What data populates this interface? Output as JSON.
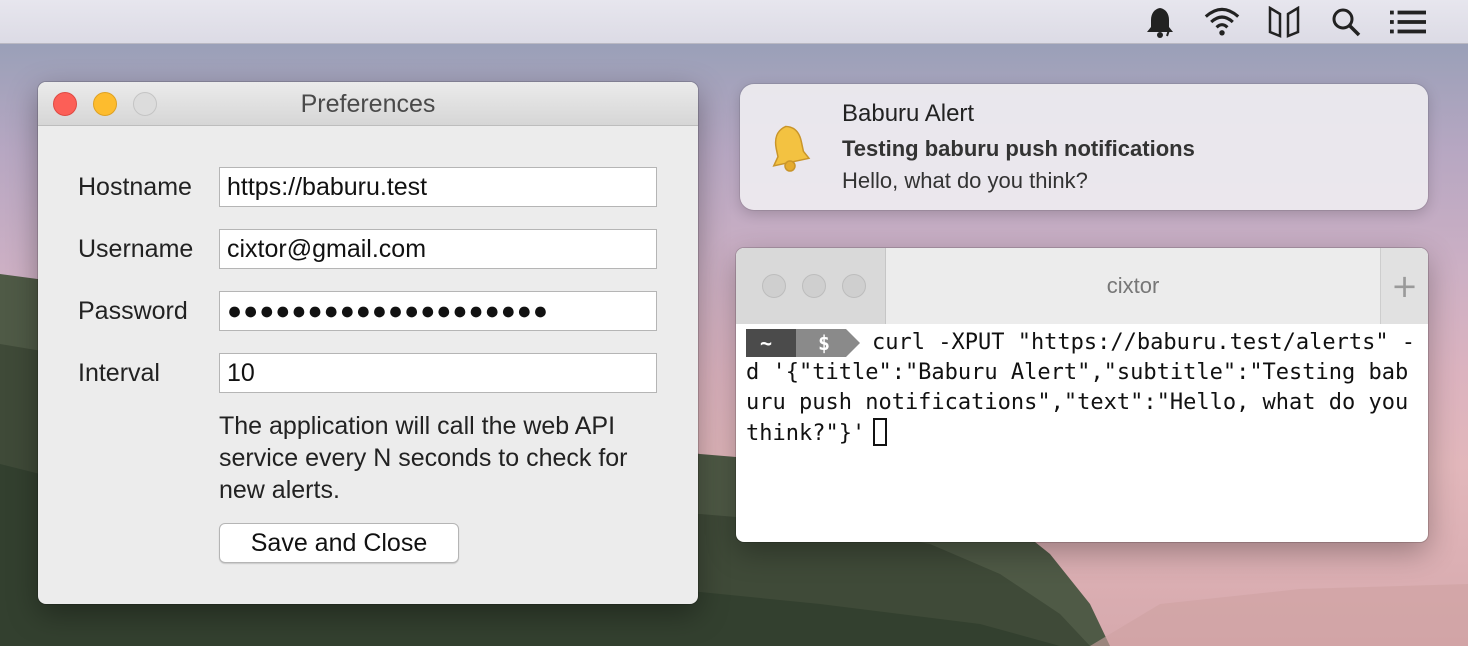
{
  "menubar": {
    "icons": [
      "bell-icon",
      "wifi-icon",
      "sidebar-split-icon",
      "search-icon",
      "list-icon"
    ]
  },
  "preferences": {
    "title": "Preferences",
    "fields": [
      {
        "label": "Hostname",
        "value": "https://baburu.test"
      },
      {
        "label": "Username",
        "value": "cixtor@gmail.com"
      },
      {
        "label": "Password",
        "value": "●●●●●●●●●●●●●●●●●●●●"
      },
      {
        "label": "Interval",
        "value": "10"
      }
    ],
    "hint": "The application will call the web API service every N seconds to check for new alerts.",
    "save_label": "Save and Close"
  },
  "notification": {
    "title": "Baburu Alert",
    "subtitle": "Testing baburu push notifications",
    "text": "Hello, what do you think?"
  },
  "terminal": {
    "title": "cixtor",
    "prompt_home": "~",
    "prompt_symbol": "$",
    "command": "curl -XPUT \"https://baburu.test/alerts\" -d '{\"title\":\"Baburu Alert\",\"subtitle\":\"Testing baburu push notifications\",\"text\":\"Hello, what do you think?\"}'",
    "new_tab": "+"
  }
}
